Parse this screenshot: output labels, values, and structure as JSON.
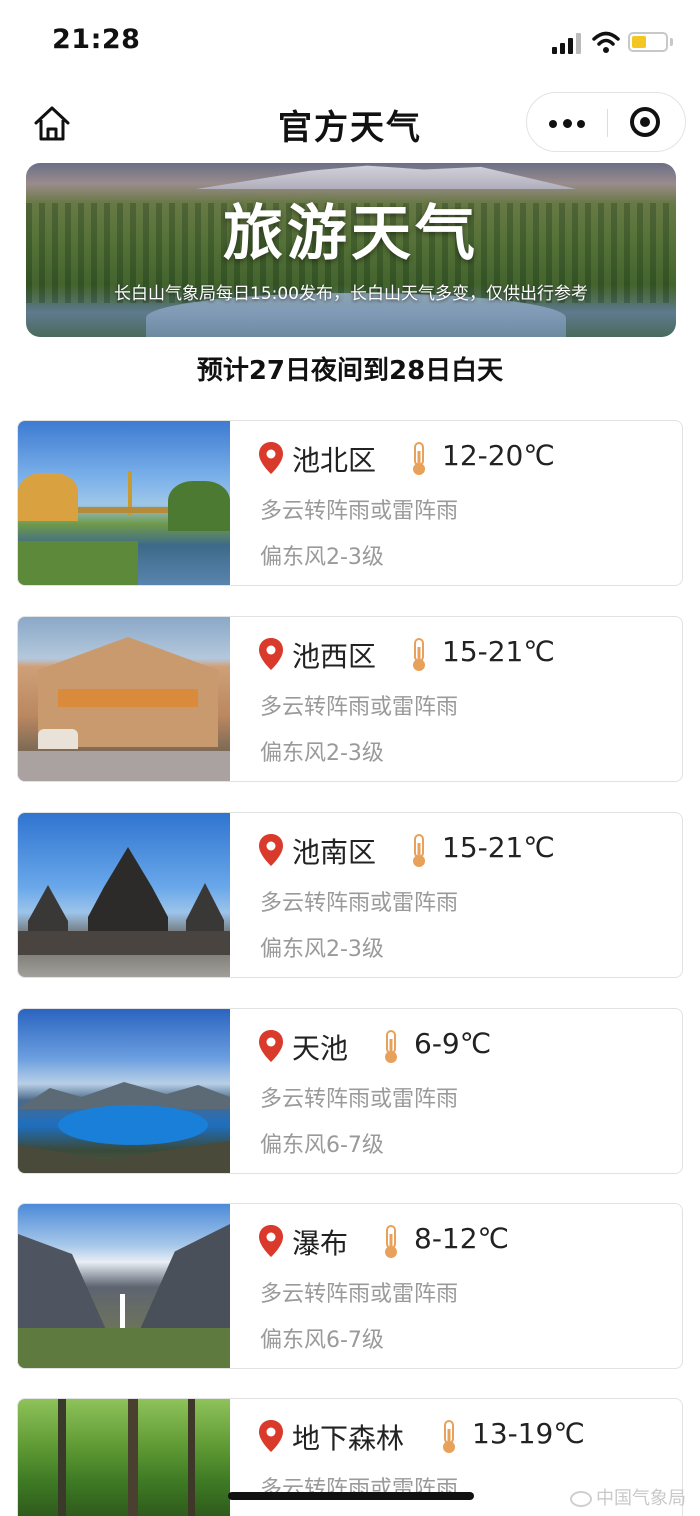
{
  "status_bar": {
    "time": "21:28"
  },
  "nav": {
    "title": "官方天气"
  },
  "banner": {
    "title": "旅游天气",
    "subtitle": "长白山气象局每日15:00发布，长白山天气多变，仅供出行参考"
  },
  "forecast_period": "预计27日夜间到28日白天",
  "locations": [
    {
      "name": "池北区",
      "temp": "12-20℃",
      "weather": "多云转阵雨或雷阵雨",
      "wind": "偏东风2-3级"
    },
    {
      "name": "池西区",
      "temp": "15-21℃",
      "weather": "多云转阵雨或雷阵雨",
      "wind": "偏东风2-3级"
    },
    {
      "name": "池南区",
      "temp": "15-21℃",
      "weather": "多云转阵雨或雷阵雨",
      "wind": "偏东风2-3级"
    },
    {
      "name": "天池",
      "temp": "6-9℃",
      "weather": "多云转阵雨或雷阵雨",
      "wind": "偏东风6-7级"
    },
    {
      "name": "瀑布",
      "temp": "8-12℃",
      "weather": "多云转阵雨或雷阵雨",
      "wind": "偏东风6-7级"
    },
    {
      "name": "地下森林",
      "temp": "13-19℃",
      "weather": "多云转阵雨或雷阵雨",
      "wind": ""
    }
  ],
  "watermark": "中国气象局",
  "colors": {
    "pin": "#d93a2b",
    "thermometer": "#e8a15a",
    "secondary_text": "#9a9a9a"
  }
}
